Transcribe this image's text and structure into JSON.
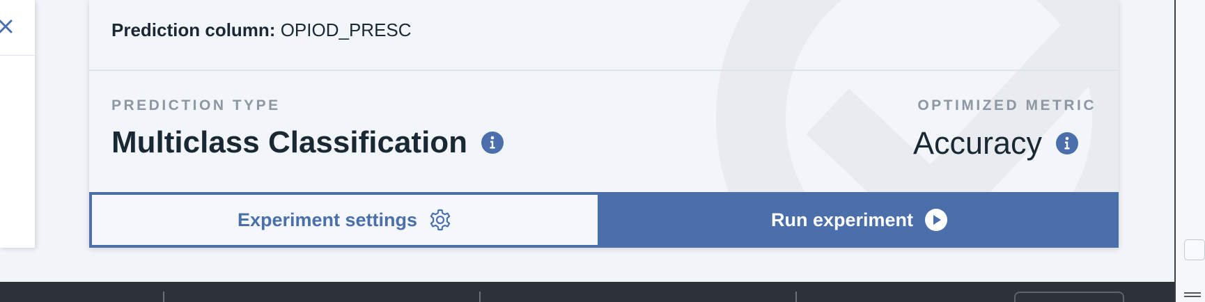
{
  "summary": {
    "prediction_column_label": "Prediction column:",
    "prediction_column_value": "OPIOD_PRESC",
    "prediction_type_heading": "PREDICTION TYPE",
    "prediction_type_value": "Multiclass Classification",
    "optimized_metric_heading": "OPTIMIZED METRIC",
    "optimized_metric_value": "Accuracy"
  },
  "actions": {
    "settings_label": "Experiment settings",
    "run_label": "Run experiment"
  },
  "icons": {
    "close": "close-icon",
    "info": "info-icon",
    "settings": "gear-icon",
    "run": "play-icon"
  },
  "colors": {
    "accent": "#4a6fab",
    "text": "#1a2833",
    "heading": "#8d97a1",
    "background": "#f1f4f8"
  }
}
